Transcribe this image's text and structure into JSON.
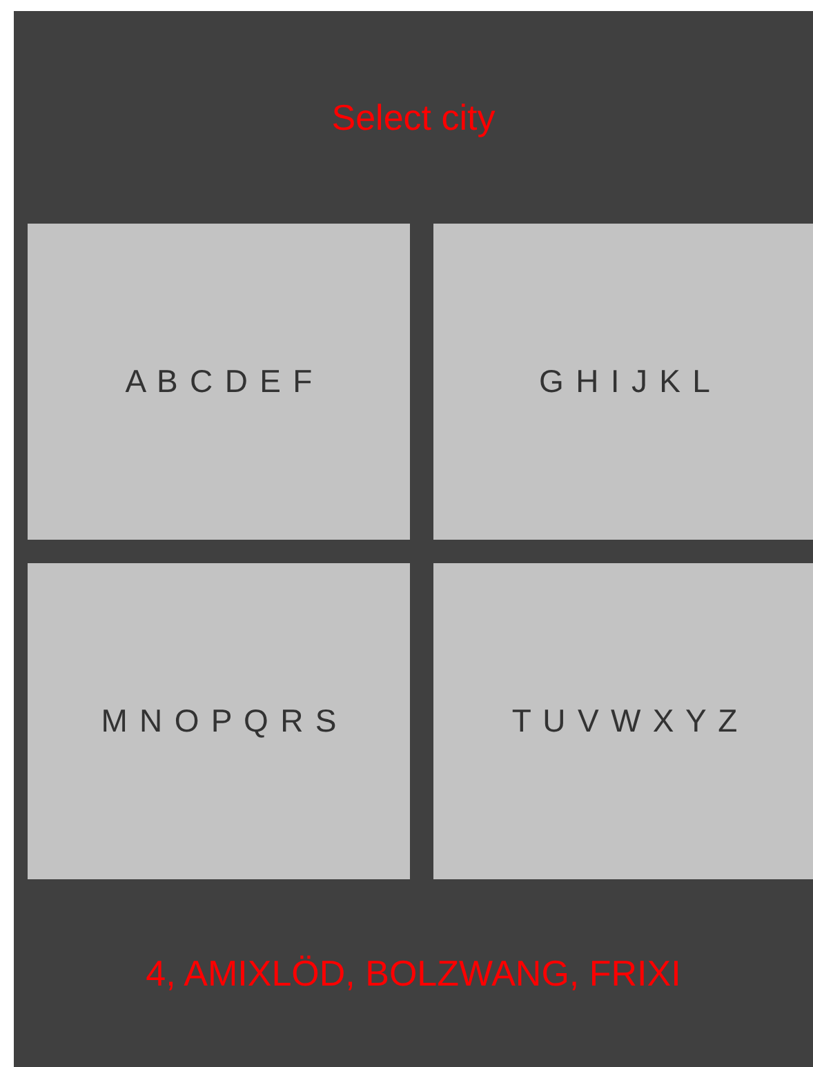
{
  "title": "Select city",
  "tiles": [
    {
      "label": "A B C D E F"
    },
    {
      "label": "G H I J K L"
    },
    {
      "label": "M N O P Q R S"
    },
    {
      "label": "T U V W X Y Z"
    }
  ],
  "footer": "4, AMIXLÖD, BOLZWANG, FRIXI"
}
